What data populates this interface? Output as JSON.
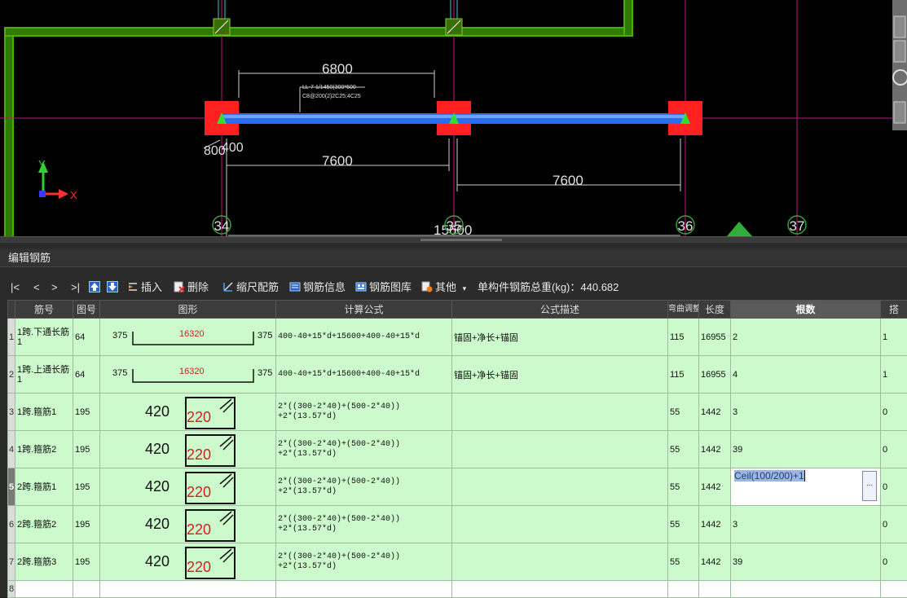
{
  "cad": {
    "dim_top": "6800",
    "dim_left_a": "800",
    "dim_left_b": "400",
    "dim_mid_left": "7600",
    "dim_mid_right": "7600",
    "dim_total": "15600",
    "note_line1": "LL-7 1/1450(300*500",
    "note_line2": "C8@200(2)2C25;4C25",
    "axes": [
      "34",
      "35",
      "36",
      "37"
    ],
    "ucs_y": "Y",
    "ucs_x": "X"
  },
  "panel": {
    "title": "编辑钢筋"
  },
  "toolbar": {
    "first": "|<",
    "prev": "<",
    "next": ">",
    "last": ">|",
    "insert": "插入",
    "delete": "删除",
    "scale_rebar": "缩尺配筋",
    "rebar_info": "钢筋信息",
    "rebar_library": "钢筋图库",
    "other": "其他",
    "total_weight": "单构件钢筋总重(kg)：440.682"
  },
  "table": {
    "headers": [
      "筋号",
      "图号",
      "图形",
      "计算公式",
      "公式描述",
      "弯曲调整",
      "长度",
      "根数",
      "搭"
    ],
    "rows": [
      {
        "n": "1",
        "name": "1跨.下通长筋1",
        "fig": "64",
        "shape": "straight",
        "s_left": "375",
        "s_mid": "16320",
        "s_right": "375",
        "formula": "400-40+15*d+15600+400-40+15*d",
        "desc": "锚固+净长+锚固",
        "bend": "115",
        "len": "16955",
        "count": "2",
        "lap": "1"
      },
      {
        "n": "2",
        "name": "1跨.上通长筋1",
        "fig": "64",
        "shape": "straight",
        "s_left": "375",
        "s_mid": "16320",
        "s_right": "375",
        "formula": "400-40+15*d+15600+400-40+15*d",
        "desc": "锚固+净长+锚固",
        "bend": "115",
        "len": "16955",
        "count": "4",
        "lap": "1"
      },
      {
        "n": "3",
        "name": "1跨.箍筋1",
        "fig": "195",
        "shape": "stirrup",
        "s_left": "420",
        "s_mid": "220",
        "s_right": "",
        "formula": "2*((300-2*40)+(500-2*40))\n+2*(13.57*d)",
        "desc": "",
        "bend": "55",
        "len": "1442",
        "count": "3",
        "lap": "0"
      },
      {
        "n": "4",
        "name": "1跨.箍筋2",
        "fig": "195",
        "shape": "stirrup",
        "s_left": "420",
        "s_mid": "220",
        "s_right": "",
        "formula": "2*((300-2*40)+(500-2*40))\n+2*(13.57*d)",
        "desc": "",
        "bend": "55",
        "len": "1442",
        "count": "39",
        "lap": "0"
      },
      {
        "n": "5",
        "name": "2跨.箍筋1",
        "fig": "195",
        "shape": "stirrup",
        "s_left": "420",
        "s_mid": "220",
        "s_right": "",
        "formula": "2*((300-2*40)+(500-2*40))\n+2*(13.57*d)",
        "desc": "",
        "bend": "55",
        "len": "1442",
        "count": "Ceil(100/200)+1",
        "lap": "0",
        "editing": true
      },
      {
        "n": "6",
        "name": "2跨.箍筋2",
        "fig": "195",
        "shape": "stirrup",
        "s_left": "420",
        "s_mid": "220",
        "s_right": "",
        "formula": "2*((300-2*40)+(500-2*40))\n+2*(13.57*d)",
        "desc": "",
        "bend": "55",
        "len": "1442",
        "count": "3",
        "lap": "0"
      },
      {
        "n": "7",
        "name": "2跨.箍筋3",
        "fig": "195",
        "shape": "stirrup",
        "s_left": "420",
        "s_mid": "220",
        "s_right": "",
        "formula": "2*((300-2*40)+(500-2*40))\n+2*(13.57*d)",
        "desc": "",
        "bend": "55",
        "len": "1442",
        "count": "39",
        "lap": "0"
      }
    ],
    "empty_row_no": "8",
    "edit_button": "..."
  },
  "colors": {
    "row_bg": "#ccfacc",
    "beam": "#2a6cf0",
    "column": "#ff2020",
    "wall": "#4caf00",
    "dim_text": "#e0e0e0"
  }
}
